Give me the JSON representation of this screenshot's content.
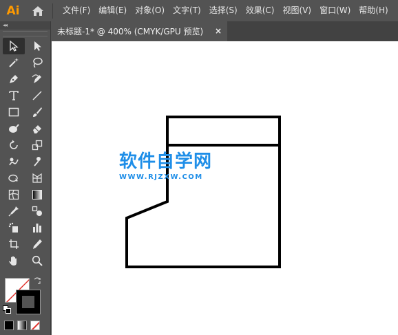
{
  "app": {
    "logo": "Ai",
    "home_icon": "home-icon",
    "menu": [
      "文件(F)",
      "编辑(E)",
      "对象(O)",
      "文字(T)",
      "选择(S)",
      "效果(C)",
      "视图(V)",
      "窗口(W)",
      "帮助(H)"
    ]
  },
  "document": {
    "tab_title": "未标题-1* @ 400% (CMYK/GPU 预览)",
    "close_symbol": "×"
  },
  "toolbar": {
    "collapse_symbol": "◂◂",
    "tools": [
      {
        "name": "selection-tool-icon",
        "active": true
      },
      {
        "name": "direct-selection-tool-icon"
      },
      {
        "name": "magic-wand-tool-icon"
      },
      {
        "name": "lasso-tool-icon"
      },
      {
        "name": "pen-tool-icon"
      },
      {
        "name": "curvature-tool-icon"
      },
      {
        "name": "type-tool-icon",
        "glyph": "T"
      },
      {
        "name": "line-segment-tool-icon"
      },
      {
        "name": "rectangle-tool-icon"
      },
      {
        "name": "paintbrush-tool-icon"
      },
      {
        "name": "shaper-tool-icon"
      },
      {
        "name": "eraser-tool-icon"
      },
      {
        "name": "rotate-tool-icon"
      },
      {
        "name": "scale-tool-icon"
      },
      {
        "name": "warp-tool-icon"
      },
      {
        "name": "puppet-warp-tool-icon"
      },
      {
        "name": "shape-builder-tool-icon"
      },
      {
        "name": "perspective-grid-tool-icon"
      },
      {
        "name": "mesh-tool-icon"
      },
      {
        "name": "gradient-tool-icon"
      },
      {
        "name": "eyedropper-tool-icon"
      },
      {
        "name": "blend-tool-icon"
      },
      {
        "name": "symbol-sprayer-tool-icon"
      },
      {
        "name": "column-graph-tool-icon"
      },
      {
        "name": "artboard-tool-icon"
      },
      {
        "name": "slice-tool-icon"
      },
      {
        "name": "hand-tool-icon"
      },
      {
        "name": "zoom-tool-icon"
      }
    ]
  },
  "colors": {
    "fill": "#ffffff",
    "stroke": "#000000",
    "ui_bg": "#535353",
    "logo": "#ff9a00",
    "watermark": "#1e8ee8"
  },
  "watermark": {
    "title": "软件自学网",
    "url": "WWW.RJZXW.COM"
  }
}
